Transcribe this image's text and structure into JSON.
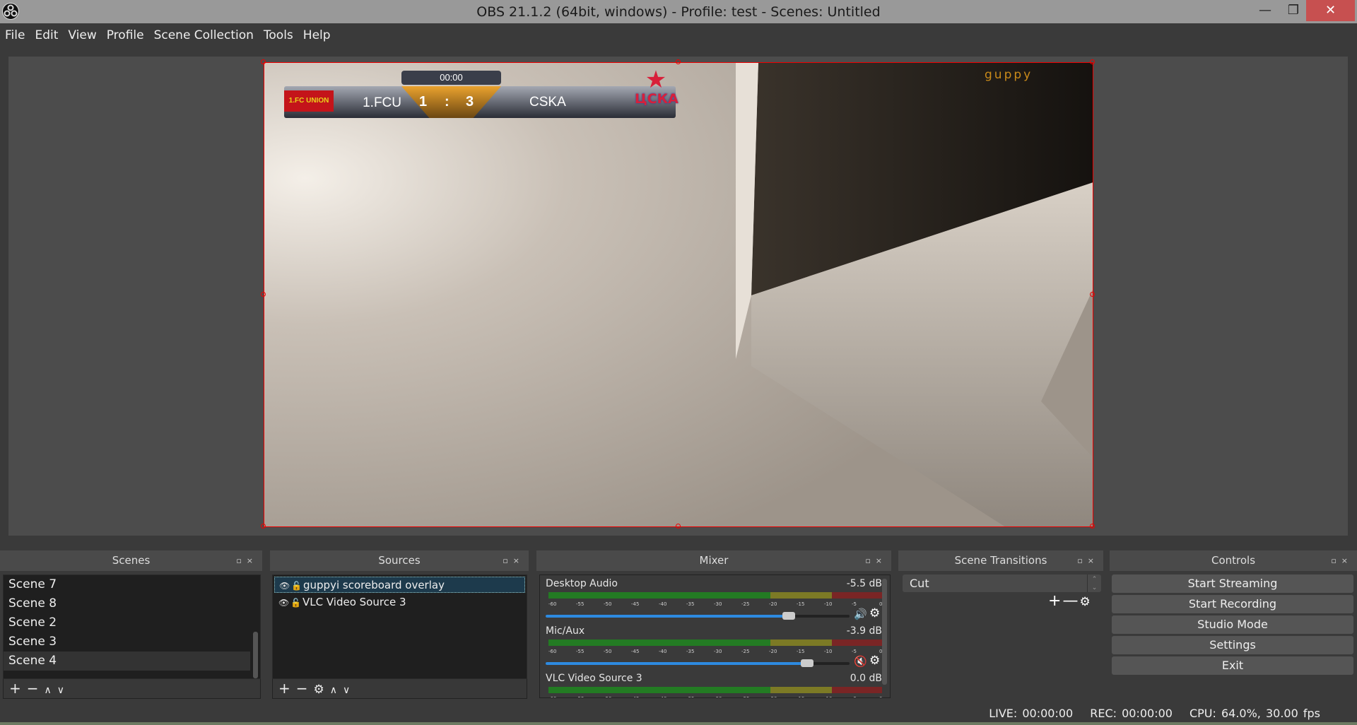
{
  "window": {
    "title": "OBS 21.1.2 (64bit, windows) - Profile: test - Scenes: Untitled",
    "minimize": "—",
    "restore": "❐",
    "close": "✕",
    "close_color": "#c75050"
  },
  "menu": [
    "File",
    "Edit",
    "View",
    "Profile",
    "Scene Collection",
    "Tools",
    "Help"
  ],
  "preview": {
    "overlay": {
      "timer": "00:00",
      "home_team": "1.FCU",
      "away_team": "CSKA",
      "home_score": "1",
      "separator": ":",
      "away_score": "3",
      "home_logo_text": "1.FC UNION",
      "away_logo_text": "ЦСКА",
      "watermark": "guppy"
    },
    "selection_color": "#e00000"
  },
  "scenes": {
    "title": "Scenes",
    "items": [
      "Scene 7",
      "Scene 8",
      "Scene 2",
      "Scene 3",
      "Scene 4"
    ],
    "selected": "Scene 4"
  },
  "sources": {
    "title": "Sources",
    "items": [
      "guppyi scoreboard overlay",
      "VLC Video Source 3"
    ],
    "selected": "guppyi scoreboard overlay"
  },
  "mixer": {
    "title": "Mixer",
    "tick_labels": [
      "-60",
      "-55",
      "-50",
      "-45",
      "-40",
      "-35",
      "-30",
      "-25",
      "-20",
      "-15",
      "-10",
      "-5",
      "0"
    ],
    "channels": [
      {
        "name": "Desktop Audio",
        "db": "-5.5 dB",
        "volume": 0.8,
        "muted": false
      },
      {
        "name": "Mic/Aux",
        "db": "-3.9 dB",
        "volume": 0.86,
        "muted": true
      },
      {
        "name": "VLC Video Source 3",
        "db": "0.0 dB",
        "volume": 1.0,
        "muted": false
      }
    ]
  },
  "transitions": {
    "title": "Scene Transitions",
    "selected": "Cut"
  },
  "controls": {
    "title": "Controls",
    "buttons": [
      "Start Streaming",
      "Start Recording",
      "Studio Mode",
      "Settings",
      "Exit"
    ]
  },
  "status": {
    "live": "LIVE: 00:00:00",
    "rec": "REC: 00:00:00",
    "cpu": "CPU: 64.0%, 30.00 fps"
  }
}
